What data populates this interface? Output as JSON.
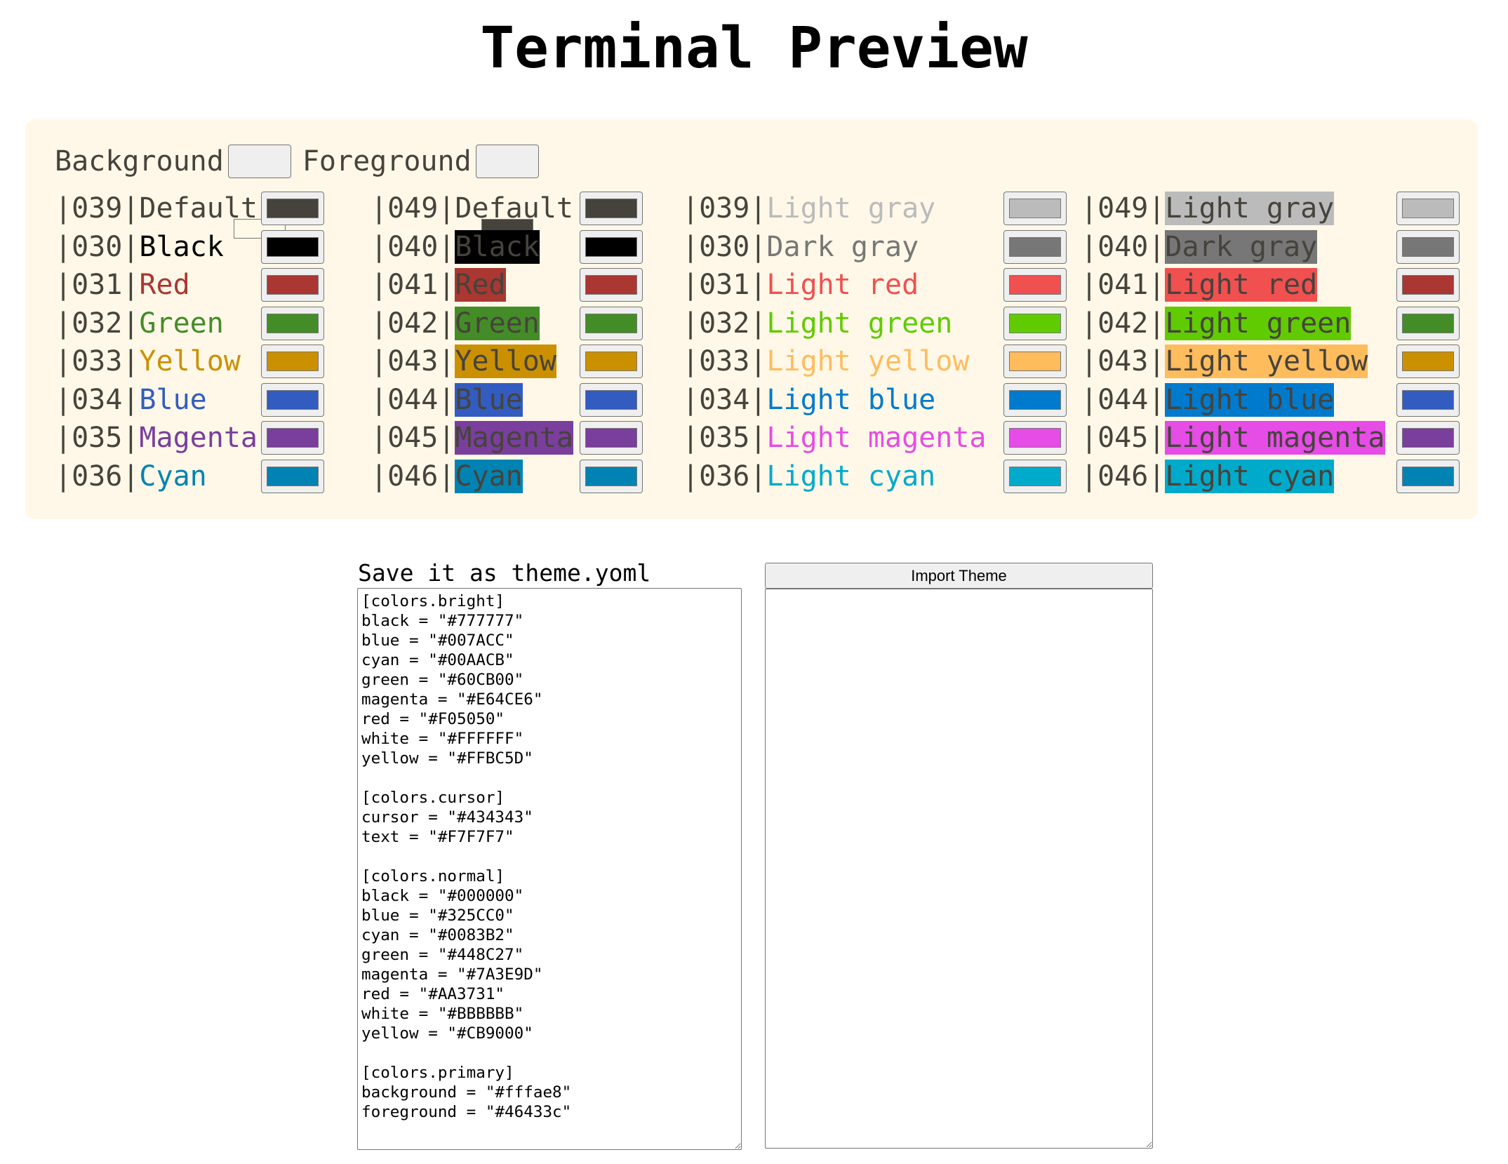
{
  "title": "Terminal Preview",
  "primary": {
    "background_label": "Background",
    "background_color": "#fffae8",
    "foreground_label": "Foreground",
    "foreground_color": "#46433c"
  },
  "columns": [
    {
      "kind": "normal-foreground",
      "rows": [
        {
          "code": "|039|",
          "name": "Default",
          "text_color": "#46433c",
          "bg": null,
          "swatch": "#46433c"
        },
        {
          "code": "|030|",
          "name": "Black",
          "text_color": "#000000",
          "bg": null,
          "swatch": "#000000"
        },
        {
          "code": "|031|",
          "name": "Red",
          "text_color": "#AA3731",
          "bg": null,
          "swatch": "#AA3731"
        },
        {
          "code": "|032|",
          "name": "Green",
          "text_color": "#448C27",
          "bg": null,
          "swatch": "#448C27"
        },
        {
          "code": "|033|",
          "name": "Yellow",
          "text_color": "#CB9000",
          "bg": null,
          "swatch": "#CB9000"
        },
        {
          "code": "|034|",
          "name": "Blue",
          "text_color": "#325CC0",
          "bg": null,
          "swatch": "#325CC0"
        },
        {
          "code": "|035|",
          "name": "Magenta",
          "text_color": "#7A3E9D",
          "bg": null,
          "swatch": "#7A3E9D"
        },
        {
          "code": "|036|",
          "name": "Cyan",
          "text_color": "#0083B2",
          "bg": null,
          "swatch": "#0083B2"
        }
      ]
    },
    {
      "kind": "normal-background",
      "rows": [
        {
          "code": "|049|",
          "name": "Default",
          "text_color": "#46433c",
          "bg": null,
          "swatch": "#46433c"
        },
        {
          "code": "|040|",
          "name": "Black",
          "text_color": "#46433c",
          "bg": "#000000",
          "swatch": "#000000"
        },
        {
          "code": "|041|",
          "name": "Red",
          "text_color": "#46433c",
          "bg": "#AA3731",
          "swatch": "#AA3731"
        },
        {
          "code": "|042|",
          "name": "Green",
          "text_color": "#46433c",
          "bg": "#448C27",
          "swatch": "#448C27"
        },
        {
          "code": "|043|",
          "name": "Yellow",
          "text_color": "#46433c",
          "bg": "#CB9000",
          "swatch": "#CB9000"
        },
        {
          "code": "|044|",
          "name": "Blue",
          "text_color": "#46433c",
          "bg": "#325CC0",
          "swatch": "#325CC0"
        },
        {
          "code": "|045|",
          "name": "Magenta",
          "text_color": "#46433c",
          "bg": "#7A3E9D",
          "swatch": "#7A3E9D"
        },
        {
          "code": "|046|",
          "name": "Cyan",
          "text_color": "#46433c",
          "bg": "#0083B2",
          "swatch": "#0083B2"
        }
      ]
    },
    {
      "kind": "bright-foreground",
      "rows": [
        {
          "code": "|039|",
          "name": "Light gray",
          "text_color": "#BBBBBB",
          "bg": null,
          "swatch": "#BBBBBB"
        },
        {
          "code": "|030|",
          "name": "Dark gray",
          "text_color": "#777777",
          "bg": null,
          "swatch": "#777777"
        },
        {
          "code": "|031|",
          "name": "Light red",
          "text_color": "#F05050",
          "bg": null,
          "swatch": "#F05050"
        },
        {
          "code": "|032|",
          "name": "Light green",
          "text_color": "#60CB00",
          "bg": null,
          "swatch": "#60CB00"
        },
        {
          "code": "|033|",
          "name": "Light yellow",
          "text_color": "#FFBC5D",
          "bg": null,
          "swatch": "#FFBC5D"
        },
        {
          "code": "|034|",
          "name": "Light blue",
          "text_color": "#007ACC",
          "bg": null,
          "swatch": "#007ACC"
        },
        {
          "code": "|035|",
          "name": "Light magenta",
          "text_color": "#E64CE6",
          "bg": null,
          "swatch": "#E64CE6"
        },
        {
          "code": "|036|",
          "name": "Light cyan",
          "text_color": "#00AACB",
          "bg": null,
          "swatch": "#00AACB"
        }
      ]
    },
    {
      "kind": "bright-background",
      "rows": [
        {
          "code": "|049|",
          "name": "Light gray",
          "text_color": "#46433c",
          "bg": "#BBBBBB",
          "swatch": "#BBBBBB"
        },
        {
          "code": "|040|",
          "name": "Dark gray",
          "text_color": "#46433c",
          "bg": "#777777",
          "swatch": "#777777"
        },
        {
          "code": "|041|",
          "name": "Light red",
          "text_color": "#46433c",
          "bg": "#F05050",
          "swatch": "#AA3731"
        },
        {
          "code": "|042|",
          "name": "Light green",
          "text_color": "#46433c",
          "bg": "#60CB00",
          "swatch": "#448C27"
        },
        {
          "code": "|043|",
          "name": "Light yellow",
          "text_color": "#46433c",
          "bg": "#FFBC5D",
          "swatch": "#CB9000"
        },
        {
          "code": "|044|",
          "name": "Light blue",
          "text_color": "#46433c",
          "bg": "#007ACC",
          "swatch": "#325CC0"
        },
        {
          "code": "|045|",
          "name": "Light magenta",
          "text_color": "#46433c",
          "bg": "#E64CE6",
          "swatch": "#7A3E9D"
        },
        {
          "code": "|046|",
          "name": "Light cyan",
          "text_color": "#46433c",
          "bg": "#00AACB",
          "swatch": "#0083B2"
        }
      ]
    }
  ],
  "export": {
    "label": "Save it as theme.yoml",
    "content": "[colors.bright]\nblack = \"#777777\"\nblue = \"#007ACC\"\ncyan = \"#00AACB\"\ngreen = \"#60CB00\"\nmagenta = \"#E64CE6\"\nred = \"#F05050\"\nwhite = \"#FFFFFF\"\nyellow = \"#FFBC5D\"\n\n[colors.cursor]\ncursor = \"#434343\"\ntext = \"#F7F7F7\"\n\n[colors.normal]\nblack = \"#000000\"\nblue = \"#325CC0\"\ncyan = \"#0083B2\"\ngreen = \"#448C27\"\nmagenta = \"#7A3E9D\"\nred = \"#AA3731\"\nwhite = \"#BBBBBB\"\nyellow = \"#CB9000\"\n\n[colors.primary]\nbackground = \"#fffae8\"\nforeground = \"#46433c\""
  },
  "import": {
    "button_label": "Import Theme",
    "content": ""
  }
}
